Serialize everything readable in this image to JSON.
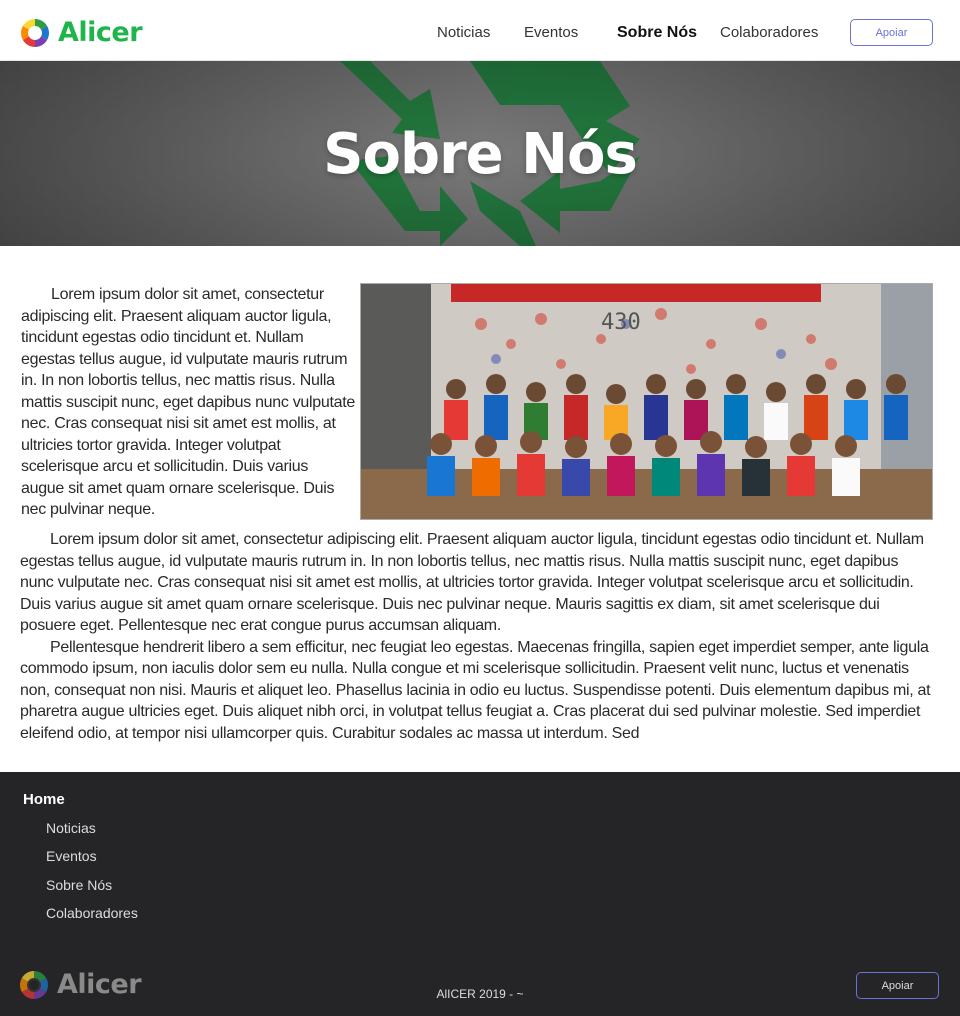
{
  "brand": {
    "name": "Alicer"
  },
  "nav": {
    "items": [
      {
        "label": "Noticias"
      },
      {
        "label": "Eventos"
      },
      {
        "label": "Sobre Nós"
      },
      {
        "label": "Colaboradores"
      }
    ],
    "active": "Sobre Nós",
    "support_label": "Apoiar"
  },
  "hero": {
    "title": "Sobre Nós"
  },
  "content": {
    "intro": "Lorem ipsum dolor sit amet, consectetur adipiscing elit. Praesent aliquam auctor ligula, tincidunt egestas odio tincidunt et. Nullam egestas tellus augue, id vulputate mauris rutrum in. In non lobortis tellus, nec mattis risus. Nulla mattis suscipit nunc, eget dapibus nunc vulputate nec. Cras consequat nisi sit amet est mollis, at ultricies tortor gravida. Integer volutpat scelerisque arcu et sollicitudin. Duis varius augue sit amet quam ornare scelerisque. Duis nec pulvinar neque.",
    "photo_sign_text": "430",
    "paragraph_1": "Lorem ipsum dolor sit amet, consectetur adipiscing elit. Praesent aliquam auctor ligula, tincidunt egestas odio tincidunt et. Nullam egestas tellus augue, id vulputate mauris rutrum in. In non lobortis tellus, nec mattis risus. Nulla mattis suscipit nunc, eget dapibus nunc vulputate nec. Cras consequat nisi sit amet est mollis, at ultricies tortor gravida. Integer volutpat scelerisque arcu et sollicitudin. Duis varius augue sit amet quam ornare scelerisque. Duis nec pulvinar neque. Mauris sagittis ex diam, sit amet scelerisque dui posuere eget. Pellentesque nec erat congue purus accumsan aliquam.",
    "paragraph_2": "Pellentesque hendrerit libero a sem efficitur, nec feugiat leo egestas. Maecenas fringilla, sapien eget imperdiet semper, ante ligula commodo ipsum, non iaculis dolor sem eu nulla. Nulla congue et mi scelerisque sollicitudin. Praesent velit nunc, luctus et venenatis non, consequat non nisi. Mauris et aliquet leo. Phasellus lacinia in odio eu luctus. Suspendisse potenti. Duis elementum dapibus mi, at pharetra augue ultricies eget. Duis aliquet nibh orci, in volutpat tellus feugiat a. Cras placerat dui sed pulvinar molestie. Sed imperdiet eleifend odio, at tempor nisi ullamcorper quis. Curabitur sodales ac massa ut interdum. Sed"
  },
  "footer": {
    "home_label": "Home",
    "links": [
      {
        "label": "Noticias"
      },
      {
        "label": "Eventos"
      },
      {
        "label": "Sobre Nós"
      },
      {
        "label": "Colaboradores"
      }
    ],
    "copyright": "AlICER 2019 - ~",
    "support_label": "Apoiar"
  },
  "colors": {
    "brand_green": "#1fb54a",
    "accent_button": "#6a73d4",
    "footer_bg": "#252427",
    "recycle_green": "#1f7a3c"
  },
  "icons": {
    "logo": "alicer-logo-icon",
    "hero": "recycle-icon"
  }
}
